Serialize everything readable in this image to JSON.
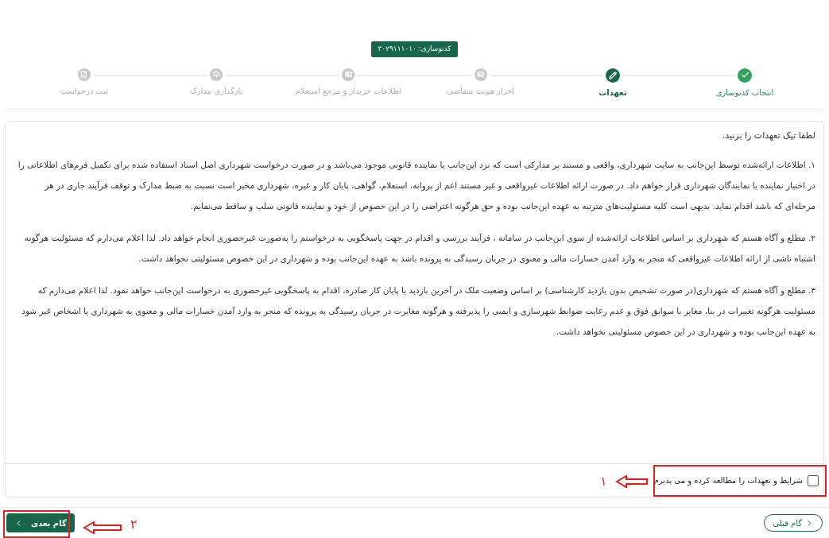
{
  "code_badge": "کدنوسازی: ۳۰۲۹۱۱۱۰۱۰",
  "steps": [
    {
      "label": "انتخاب کدنوسازی",
      "kind": "done"
    },
    {
      "label": "تعهدات",
      "kind": "current"
    },
    {
      "label": "احراز هویت متقاضی",
      "kind": "pending"
    },
    {
      "label": "اطلاعات خریدار و مرجع استعلام",
      "kind": "pending"
    },
    {
      "label": "بارگذاری مدارک",
      "kind": "pending"
    },
    {
      "label": "ثبت درخواست",
      "kind": "pending"
    }
  ],
  "instruction": "لطفا تیک تعهدات را بزنید.",
  "commitments": [
    "۱. اطلاعات ارائه‌شده توسط این‌جانب به سایت شهرداری، واقعی و مستند بر مدارکی است که نزد این‌جانب یا نماینده قانونی موجود می‌باشد و در صورت درخواست شهرداری اصل اسناد استفاده شده برای تکمیل فرم‌های اطلاعاتی را در اختیار نماینده یا نمایندگان شهرداری قرار خواهم داد. در صورت ارائه اطلاعات غیرواقعی و غیر مستند اعم از پروانه، استعلام، گواهی، پایان کار و غیره، شهرداری مخیر است نسبت به ضبط مدارک و توقف فرآیند جاری در هر مرحله‌ای که باشد اقدام نماید. بدیهی است کلیه مسئولیت‌های مترتبه به عهده این‌جانب بوده و حق هرگونه اعتراضی را در این خصوص از خود و نماینده قانونی سلب و ساقط می‌نمایم.",
    "۲. مطلع و آگاه هستم که شهرداری بر اساس اطلاعات ارائه‌شده از سوی این‌جانب در سامانه ، فرآیند بررسی و اقدام در جهت پاسخگویی به درخواستم را به‌صورت غیرحضوری انجام خواهد داد. لذا اعلام می‌دارم که مسئولیت هرگونه اشتباه ناشی از ارائه اطلاعات غیرواقعی که منجر به وارد آمدن خسارات مالی و معنوی در جریان رسیدگی به پرونده باشد به عهده این‌جانب بوده و شهرداری در این خصوص مسئولیتی نخواهد داشت.",
    "۳. مطلع و آگاه هستم که شهرداری(در صورت تشخیص بدون بازدید کارشناسی) بر اساس وضعیت ملک در آخرین بازدید یا پایان کار صادره، اقدام به پاسخگویی غیرحضوری به درخواست این‌جانب خواهد نمود. لذا اعلام می‌دارم که مسئولیت هرگونه تغییرات در بنا، مغایر با سوابق فوق و عدم رعایت ضوابط شهرسازی و ایمنی را پذیرفته و هرگونه مغایرت در جریان رسیدگی به پرونده که منجر به وارد آمدن خسارات مالی و معنوی به شهرداری یا اشخاص غیر شود به عهده این‌جانب بوده و شهرداری در این خصوص مسئولیتی نخواهد داشت."
  ],
  "agreement": {
    "label": "شرایط و تعهدات را مطالعه کرده و می پذیرم",
    "checked": false
  },
  "buttons": {
    "previous": "گام قبلی",
    "next": "گام بعدی"
  },
  "annotations": [
    {
      "number": "۱"
    },
    {
      "number": "۲"
    }
  ]
}
